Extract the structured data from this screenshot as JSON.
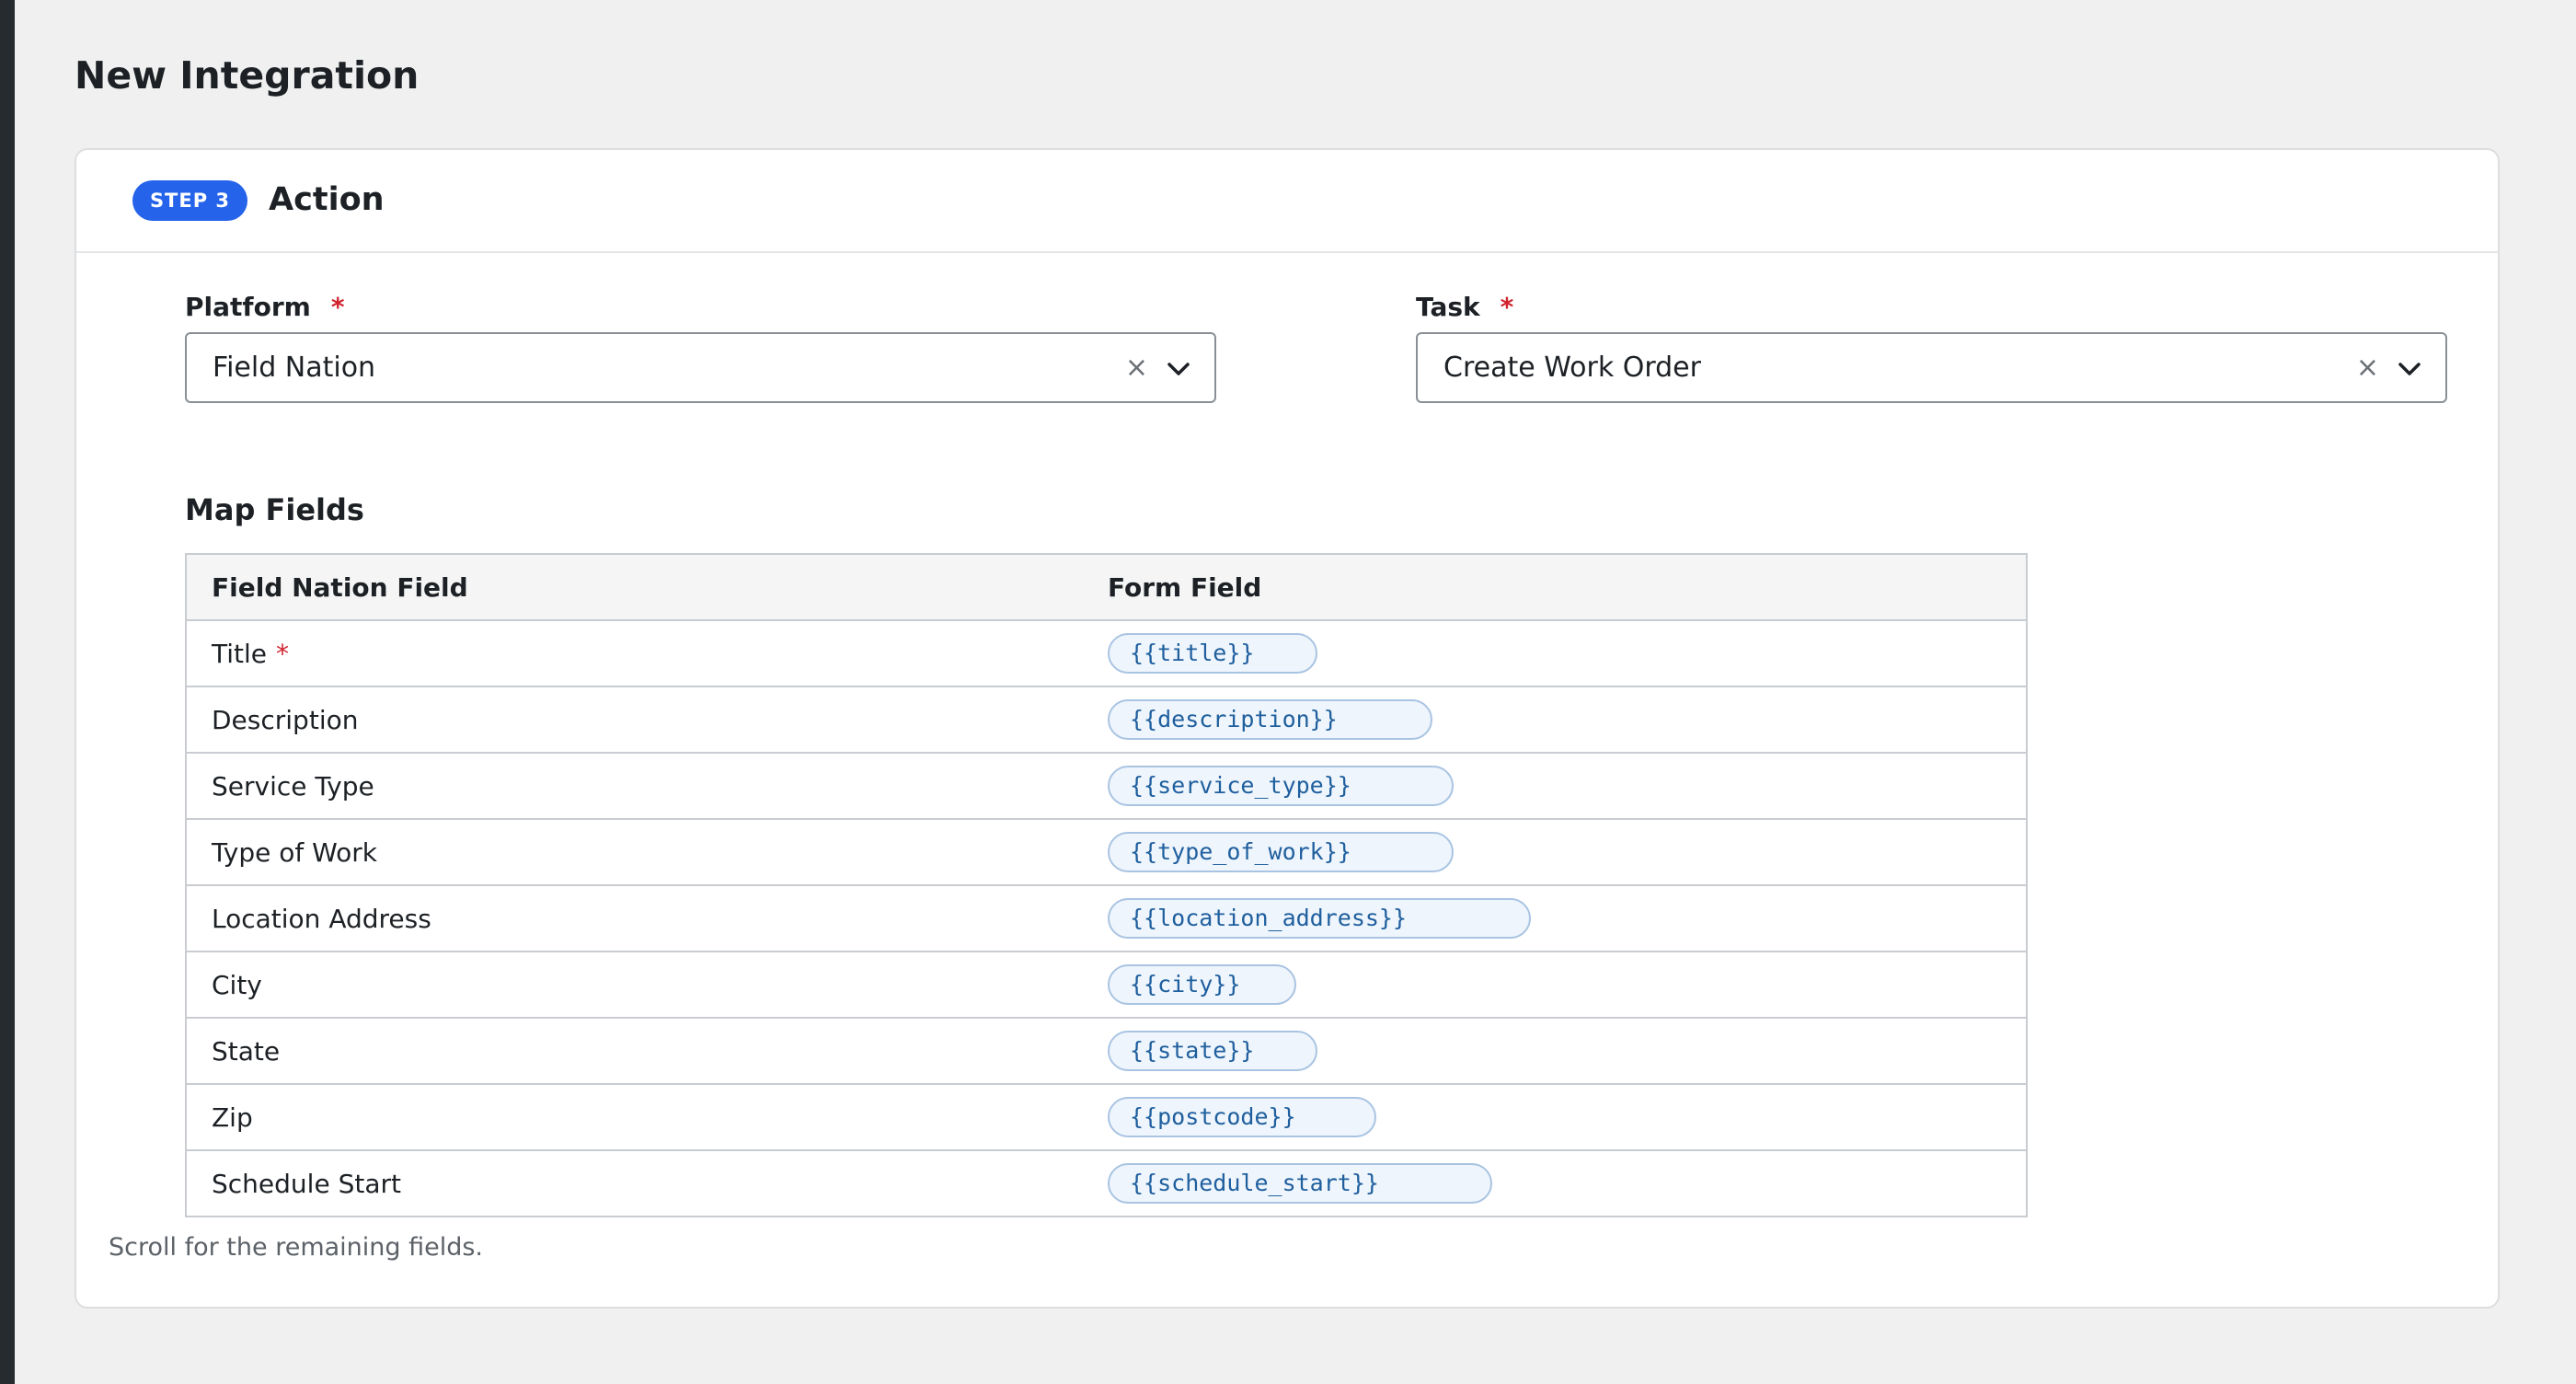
{
  "page": {
    "title": "New Integration"
  },
  "step": {
    "badge": "STEP 3",
    "title": "Action"
  },
  "platform": {
    "label": "Platform",
    "required_mark": "*",
    "value": "Field Nation",
    "clear_glyph": "×"
  },
  "task": {
    "label": "Task",
    "required_mark": "*",
    "value": "Create Work Order",
    "clear_glyph": "×"
  },
  "map_fields": {
    "title": "Map Fields",
    "columns": [
      "Field Nation Field",
      "Form Field"
    ],
    "rows": [
      {
        "field": "Title",
        "required": "*",
        "token": "{{title}}"
      },
      {
        "field": "Description",
        "token": "{{description}}"
      },
      {
        "field": "Service Type",
        "token": "{{service_type}}"
      },
      {
        "field": "Type of Work",
        "token": "{{type_of_work}}"
      },
      {
        "field": "Location Address",
        "token": "{{location_address}}"
      },
      {
        "field": "City",
        "token": "{{city}}"
      },
      {
        "field": "State",
        "token": "{{state}}"
      },
      {
        "field": "Zip",
        "token": "{{postcode}}"
      },
      {
        "field": "Schedule Start",
        "token": "{{schedule_start}}"
      }
    ],
    "hint": "Scroll for the remaining fields."
  },
  "colors": {
    "accent": "#2563eb",
    "required": "#d1242f",
    "token_text": "#1f5f9e",
    "token_bg": "#eef5fc"
  },
  "icons": {
    "clear": "close-icon",
    "dropdown": "chevron-down-icon"
  }
}
